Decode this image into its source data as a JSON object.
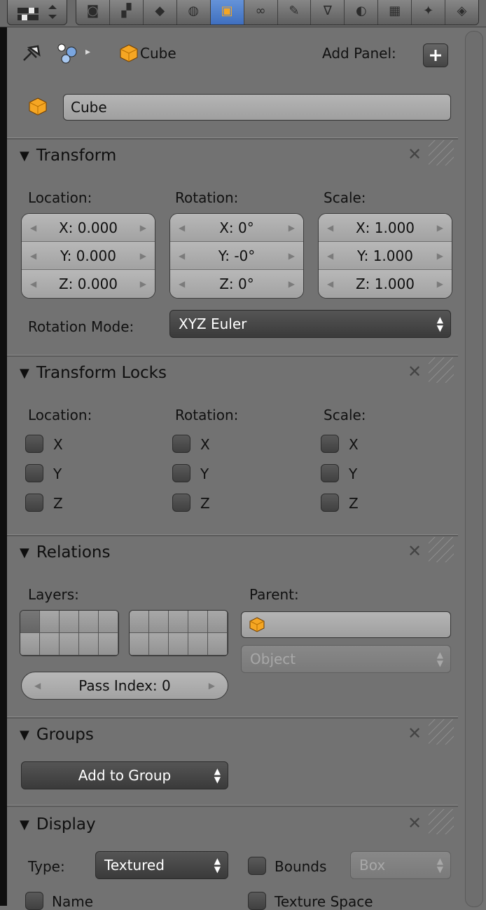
{
  "toolbar": {
    "tabs": [
      {
        "name": "render-tab",
        "glyph": "◙"
      },
      {
        "name": "render-layers-tab",
        "glyph": "▞"
      },
      {
        "name": "scene-tab",
        "glyph": "◆"
      },
      {
        "name": "world-tab",
        "glyph": "◍"
      },
      {
        "name": "object-tab",
        "glyph": "▣",
        "active": true
      },
      {
        "name": "constraints-tab",
        "glyph": "∞"
      },
      {
        "name": "modifiers-tab",
        "glyph": "✎"
      },
      {
        "name": "data-tab",
        "glyph": "∇"
      },
      {
        "name": "material-tab",
        "glyph": "◐"
      },
      {
        "name": "texture-tab",
        "glyph": "▦"
      },
      {
        "name": "particles-tab",
        "glyph": "✦"
      },
      {
        "name": "physics-tab",
        "glyph": "◈"
      }
    ]
  },
  "context": {
    "breadcrumb_label": "Cube",
    "add_panel_label": "Add Panel:",
    "object_name": "Cube"
  },
  "transform": {
    "title": "Transform",
    "location_label": "Location:",
    "rotation_label": "Rotation:",
    "scale_label": "Scale:",
    "location": [
      "X: 0.000",
      "Y: 0.000",
      "Z: 0.000"
    ],
    "rotation": [
      "X: 0°",
      "Y: -0°",
      "Z: 0°"
    ],
    "scale": [
      "X: 1.000",
      "Y: 1.000",
      "Z: 1.000"
    ],
    "rotation_mode_label": "Rotation Mode:",
    "rotation_mode_value": "XYZ Euler"
  },
  "transform_locks": {
    "title": "Transform Locks",
    "location_label": "Location:",
    "rotation_label": "Rotation:",
    "scale_label": "Scale:",
    "axes": [
      "X",
      "Y",
      "Z"
    ]
  },
  "relations": {
    "title": "Relations",
    "layers_label": "Layers:",
    "parent_label": "Parent:",
    "parent_type": "Object",
    "pass_index": "Pass Index: 0"
  },
  "groups": {
    "title": "Groups",
    "add_to_group": "Add to Group"
  },
  "display": {
    "title": "Display",
    "type_label": "Type:",
    "type_value": "Textured",
    "bounds_label": "Bounds",
    "bounds_type": "Box",
    "name_label": "Name",
    "texture_space_label": "Texture Space"
  },
  "colors": {
    "panel_bg": "#727272",
    "active_tab": "#5585d0",
    "cube_orange": "#f5a623"
  }
}
